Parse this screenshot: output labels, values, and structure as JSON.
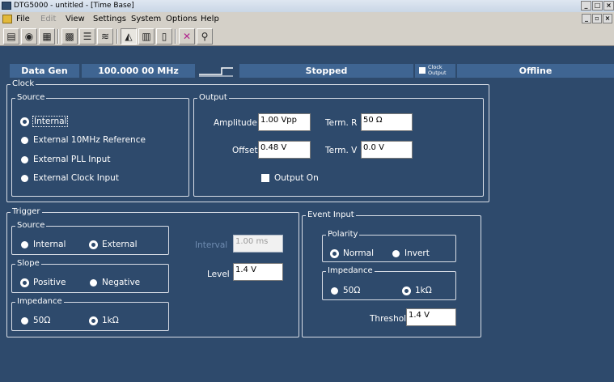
{
  "window": {
    "title": "DTG5000 - untitled - [Time Base]",
    "buttons": [
      "_",
      "□",
      "×"
    ]
  },
  "menubar": {
    "items": [
      {
        "label": "File",
        "enabled": true
      },
      {
        "label": "Edit",
        "enabled": false
      },
      {
        "label": "View",
        "enabled": true
      },
      {
        "label": "Settings",
        "enabled": true
      },
      {
        "label": "System",
        "enabled": true
      },
      {
        "label": "Options",
        "enabled": true
      },
      {
        "label": "Help",
        "enabled": true
      }
    ],
    "mdi_buttons": [
      "_",
      "▫",
      "×"
    ]
  },
  "toolbar": {
    "buttons": [
      {
        "icon": "setup-icon",
        "glyph": "▤"
      },
      {
        "icon": "globe-icon",
        "glyph": "◉"
      },
      {
        "icon": "pattern-icon",
        "glyph": "▦"
      },
      {
        "icon": "grid-icon",
        "glyph": "▩"
      },
      {
        "icon": "sequence-icon",
        "glyph": "☰"
      },
      {
        "icon": "waveform-icon",
        "glyph": "≋"
      },
      {
        "icon": "timebase-icon",
        "glyph": "◭"
      },
      {
        "icon": "level-icon",
        "glyph": "▥"
      },
      {
        "icon": "output-icon",
        "glyph": "▯"
      },
      {
        "icon": "stop-icon",
        "glyph": "✕"
      },
      {
        "icon": "probe-icon",
        "glyph": "⚲"
      }
    ]
  },
  "status": {
    "mode": "Data Gen",
    "frequency": "100.000 00 MHz",
    "run_state": "Stopped",
    "clock_output_label": "Clock Output",
    "online_state": "Offline"
  },
  "clock": {
    "label": "Clock",
    "source": {
      "label": "Source",
      "options": [
        {
          "label": "Internal",
          "selected": true
        },
        {
          "label": "External 10MHz Reference",
          "selected": false
        },
        {
          "label": "External PLL Input",
          "selected": false
        },
        {
          "label": "External Clock Input",
          "selected": false
        }
      ]
    },
    "output": {
      "label": "Output",
      "amplitude_label": "Amplitude",
      "amplitude_value": "1.00 Vpp",
      "term_r_label": "Term. R",
      "term_r_value": "50 Ω",
      "offset_label": "Offset",
      "offset_value": "0.48 V",
      "term_v_label": "Term. V",
      "term_v_value": "0.0 V",
      "output_on_label": "Output On",
      "output_on": false
    }
  },
  "trigger": {
    "label": "Trigger",
    "source": {
      "label": "Source",
      "options": [
        {
          "label": "Internal",
          "selected": false
        },
        {
          "label": "External",
          "selected": true
        }
      ]
    },
    "slope": {
      "label": "Slope",
      "options": [
        {
          "label": "Positive",
          "selected": true
        },
        {
          "label": "Negative",
          "selected": false
        }
      ]
    },
    "impedance": {
      "label": "Impedance",
      "options": [
        {
          "label": "50Ω",
          "selected": false
        },
        {
          "label": "1kΩ",
          "selected": true
        }
      ]
    },
    "interval_label": "Interval",
    "interval_value": "1.00 ms",
    "level_label": "Level",
    "level_value": "1.4 V"
  },
  "event_input": {
    "label": "Event Input",
    "polarity": {
      "label": "Polarity",
      "options": [
        {
          "label": "Normal",
          "selected": true
        },
        {
          "label": "Invert",
          "selected": false
        }
      ]
    },
    "impedance": {
      "label": "Impedance",
      "options": [
        {
          "label": "50Ω",
          "selected": false
        },
        {
          "label": "1kΩ",
          "selected": true
        }
      ]
    },
    "threshold_label": "Threshold",
    "threshold_value": "1.4 V"
  },
  "colors": {
    "panel_bg": "#2e4a6c",
    "status_bg": "#3f6592",
    "frame_line": "#d8dde6",
    "chrome": "#d4d0c8"
  }
}
